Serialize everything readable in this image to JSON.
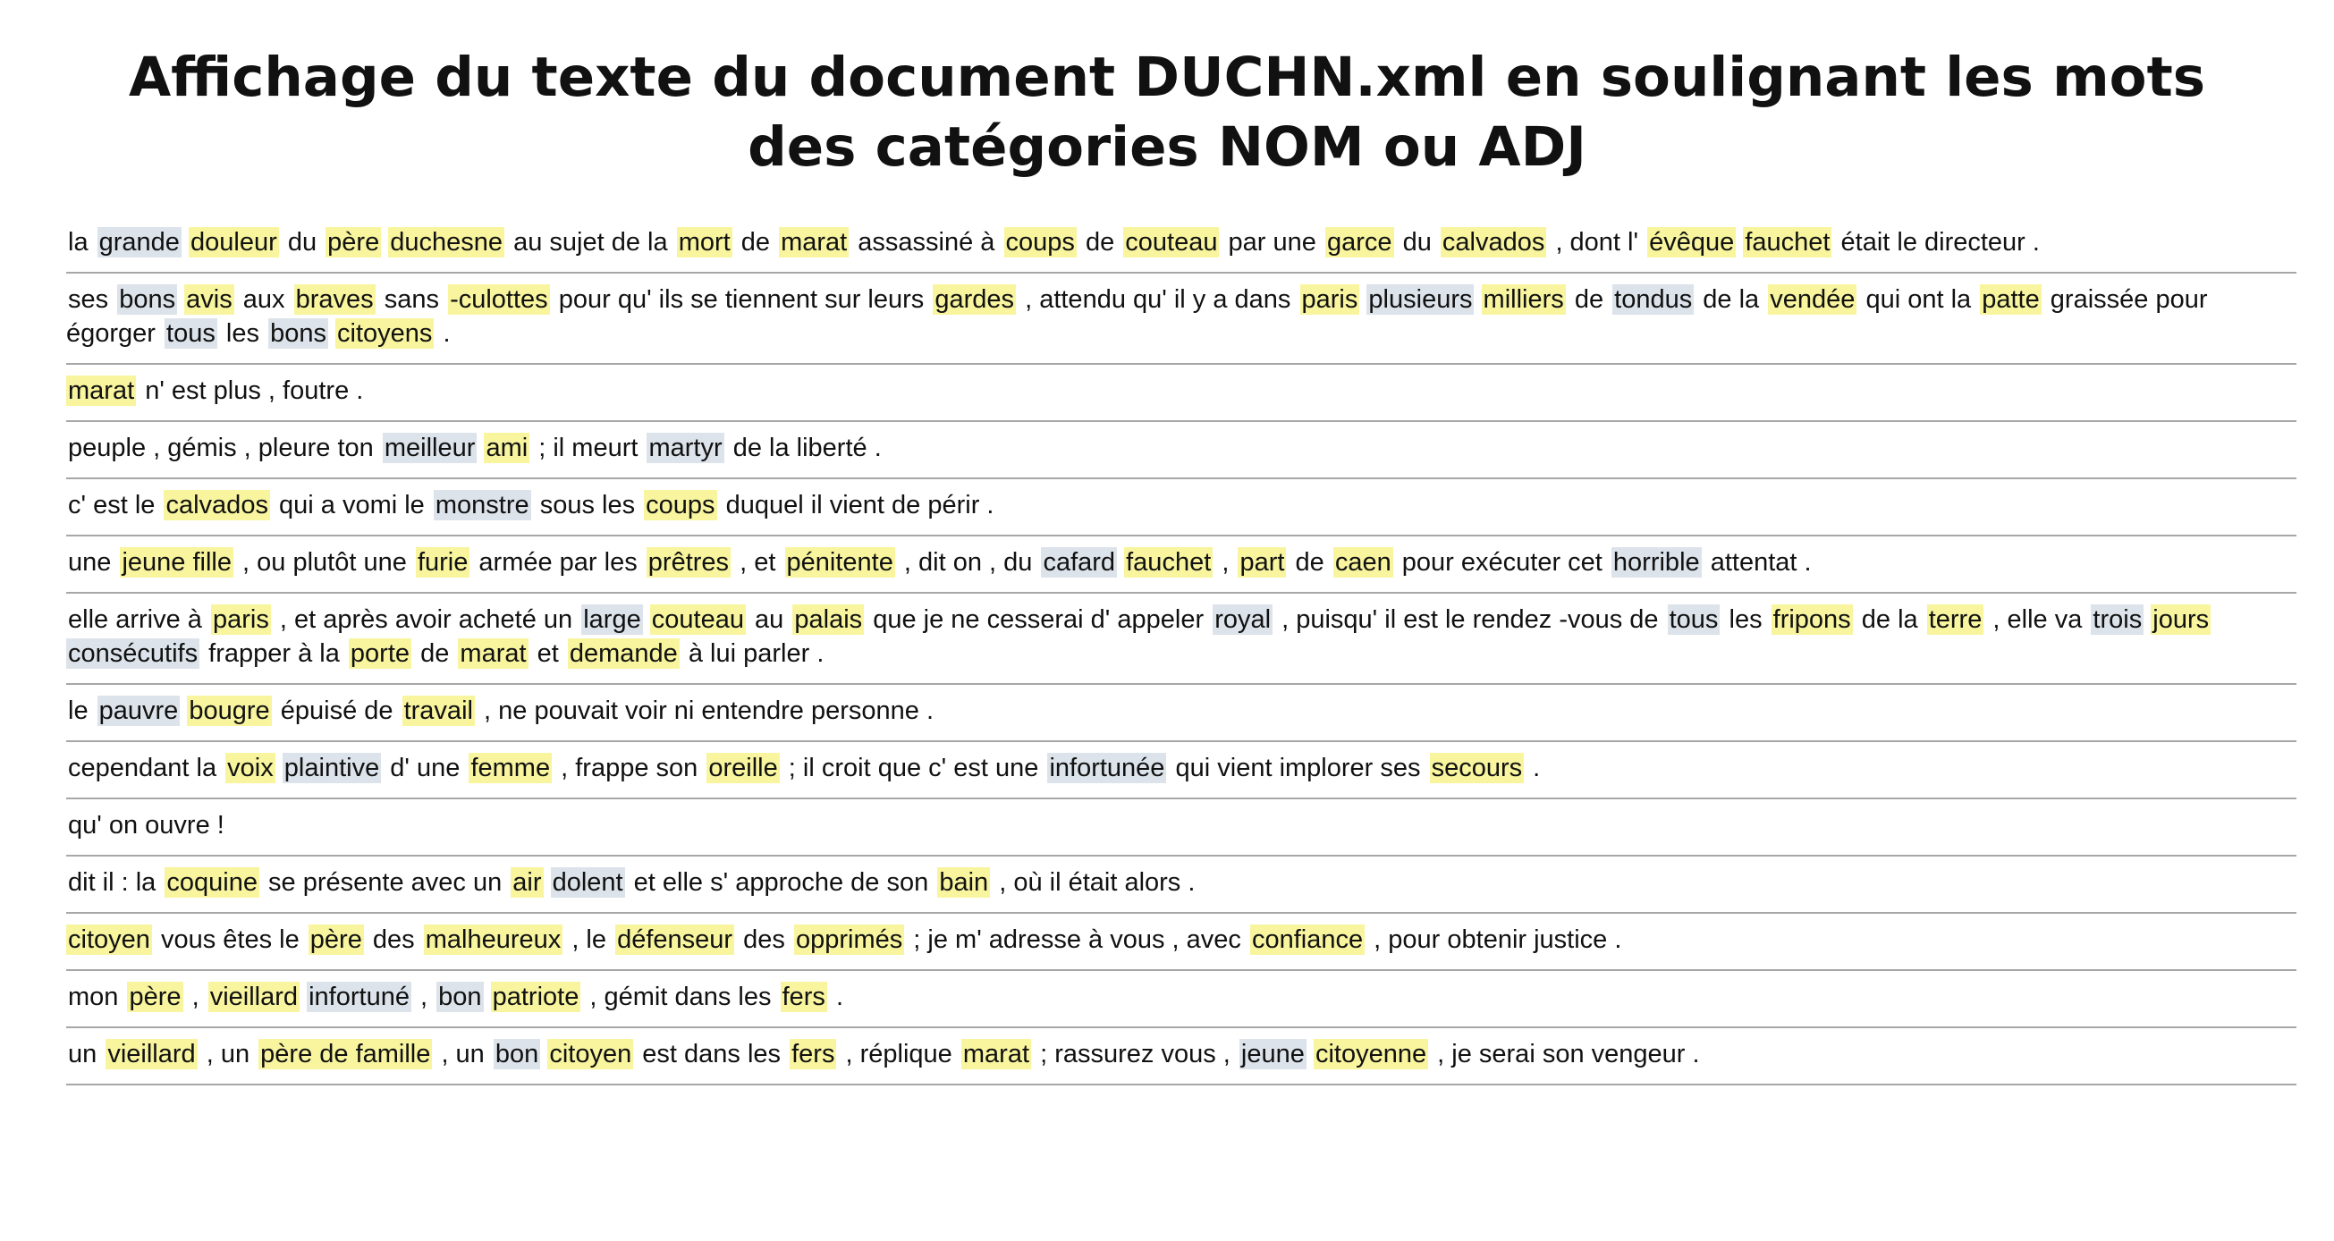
{
  "title": "Affichage du texte du document DUCHN.xml en soulignant les mots des catégories NOM ou ADJ",
  "colors": {
    "nom_highlight": "#f8f59e",
    "adj_highlight": "#dce3ea",
    "separator": "#a7a7a7"
  },
  "sentences": [
    [
      [
        "la",
        ""
      ],
      [
        "grande",
        "ADJ"
      ],
      [
        "douleur",
        "NOM"
      ],
      [
        "du",
        ""
      ],
      [
        "père",
        "NOM"
      ],
      [
        "duchesne",
        "NOM"
      ],
      [
        "au sujet de la",
        ""
      ],
      [
        "mort",
        "NOM"
      ],
      [
        "de",
        ""
      ],
      [
        "marat",
        "NOM"
      ],
      [
        "assassiné à",
        ""
      ],
      [
        "coups",
        "NOM"
      ],
      [
        "de",
        ""
      ],
      [
        "couteau",
        "NOM"
      ],
      [
        "par une",
        ""
      ],
      [
        "garce",
        "NOM"
      ],
      [
        "du",
        ""
      ],
      [
        "calvados",
        "NOM"
      ],
      [
        ", dont l'",
        ""
      ],
      [
        "évêque",
        "NOM"
      ],
      [
        "fauchet",
        "NOM"
      ],
      [
        "était le directeur .",
        ""
      ]
    ],
    [
      [
        "ses",
        ""
      ],
      [
        "bons",
        "ADJ"
      ],
      [
        "avis",
        "NOM"
      ],
      [
        "aux",
        ""
      ],
      [
        "braves",
        "NOM"
      ],
      [
        "sans",
        ""
      ],
      [
        "-culottes",
        "NOM"
      ],
      [
        "pour qu' ils se tiennent sur leurs",
        ""
      ],
      [
        "gardes",
        "NOM"
      ],
      [
        ", attendu qu' il y a dans",
        ""
      ],
      [
        "paris",
        "NOM"
      ],
      [
        "plusieurs",
        "ADJ"
      ],
      [
        "milliers",
        "NOM"
      ],
      [
        "de",
        ""
      ],
      [
        "tondus",
        "ADJ"
      ],
      [
        "de la",
        ""
      ],
      [
        "vendée",
        "NOM"
      ],
      [
        "qui ont la",
        ""
      ],
      [
        "patte",
        "NOM"
      ],
      [
        "graissée pour égorger",
        ""
      ],
      [
        "tous",
        "ADJ"
      ],
      [
        "les",
        ""
      ],
      [
        "bons",
        "ADJ"
      ],
      [
        "citoyens",
        "NOM"
      ],
      [
        ".",
        ""
      ]
    ],
    [
      [
        "marat",
        "NOM"
      ],
      [
        "n' est plus , foutre .",
        ""
      ]
    ],
    [
      [
        "peuple , gémis , pleure ton",
        ""
      ],
      [
        "meilleur",
        "ADJ"
      ],
      [
        "ami",
        "NOM"
      ],
      [
        "; il meurt",
        ""
      ],
      [
        "martyr",
        "ADJ"
      ],
      [
        "de la liberté .",
        ""
      ]
    ],
    [
      [
        "c' est le",
        ""
      ],
      [
        "calvados",
        "NOM"
      ],
      [
        "qui a vomi le",
        ""
      ],
      [
        "monstre",
        "ADJ"
      ],
      [
        "sous les",
        ""
      ],
      [
        "coups",
        "NOM"
      ],
      [
        "duquel il vient de périr .",
        ""
      ]
    ],
    [
      [
        "une",
        ""
      ],
      [
        "jeune fille",
        "NOM"
      ],
      [
        ", ou plutôt une",
        ""
      ],
      [
        "furie",
        "NOM"
      ],
      [
        "armée par les",
        ""
      ],
      [
        "prêtres",
        "NOM"
      ],
      [
        ", et",
        ""
      ],
      [
        "pénitente",
        "NOM"
      ],
      [
        ", dit on , du",
        ""
      ],
      [
        "cafard",
        "ADJ"
      ],
      [
        "fauchet",
        "NOM"
      ],
      [
        ",",
        ""
      ],
      [
        "part",
        "NOM"
      ],
      [
        "de",
        ""
      ],
      [
        "caen",
        "NOM"
      ],
      [
        "pour exécuter cet",
        ""
      ],
      [
        "horrible",
        "ADJ"
      ],
      [
        "attentat .",
        ""
      ]
    ],
    [
      [
        "elle arrive à",
        ""
      ],
      [
        "paris",
        "NOM"
      ],
      [
        ", et après avoir acheté un",
        ""
      ],
      [
        "large",
        "ADJ"
      ],
      [
        "couteau",
        "NOM"
      ],
      [
        "au",
        ""
      ],
      [
        "palais",
        "NOM"
      ],
      [
        "que je ne cesserai d' appeler",
        ""
      ],
      [
        "royal",
        "ADJ"
      ],
      [
        ", puisqu' il est le rendez -vous de",
        ""
      ],
      [
        "tous",
        "ADJ"
      ],
      [
        "les",
        ""
      ],
      [
        "fripons",
        "NOM"
      ],
      [
        "de la",
        ""
      ],
      [
        "terre",
        "NOM"
      ],
      [
        ", elle va",
        ""
      ],
      [
        "trois",
        "ADJ"
      ],
      [
        "jours",
        "NOM"
      ],
      [
        "consécutifs",
        "ADJ"
      ],
      [
        "frapper à la",
        ""
      ],
      [
        "porte",
        "NOM"
      ],
      [
        "de",
        ""
      ],
      [
        "marat",
        "NOM"
      ],
      [
        "et",
        ""
      ],
      [
        "demande",
        "NOM"
      ],
      [
        "à lui parler .",
        ""
      ]
    ],
    [
      [
        "le",
        ""
      ],
      [
        "pauvre",
        "ADJ"
      ],
      [
        "bougre",
        "NOM"
      ],
      [
        "épuisé de",
        ""
      ],
      [
        "travail",
        "NOM"
      ],
      [
        ", ne pouvait voir ni entendre personne .",
        ""
      ]
    ],
    [
      [
        "cependant la",
        ""
      ],
      [
        "voix",
        "NOM"
      ],
      [
        "plaintive",
        "ADJ"
      ],
      [
        "d' une",
        ""
      ],
      [
        "femme",
        "NOM"
      ],
      [
        ", frappe son",
        ""
      ],
      [
        "oreille",
        "NOM"
      ],
      [
        "; il croit que c' est une",
        ""
      ],
      [
        "infortunée",
        "ADJ"
      ],
      [
        "qui vient implorer ses",
        ""
      ],
      [
        "secours",
        "NOM"
      ],
      [
        ".",
        ""
      ]
    ],
    [
      [
        "qu' on ouvre !",
        ""
      ]
    ],
    [
      [
        "dit il : la",
        ""
      ],
      [
        "coquine",
        "NOM"
      ],
      [
        "se présente avec un",
        ""
      ],
      [
        "air",
        "NOM"
      ],
      [
        "dolent",
        "ADJ"
      ],
      [
        "et elle s' approche de son",
        ""
      ],
      [
        "bain",
        "NOM"
      ],
      [
        ", où il était alors .",
        ""
      ]
    ],
    [
      [
        "citoyen",
        "NOM"
      ],
      [
        "vous êtes le",
        ""
      ],
      [
        "père",
        "NOM"
      ],
      [
        "des",
        ""
      ],
      [
        "malheureux",
        "NOM"
      ],
      [
        ", le",
        ""
      ],
      [
        "défenseur",
        "NOM"
      ],
      [
        "des",
        ""
      ],
      [
        "opprimés",
        "NOM"
      ],
      [
        "; je m' adresse à vous , avec",
        ""
      ],
      [
        "confiance",
        "NOM"
      ],
      [
        ", pour obtenir justice .",
        ""
      ]
    ],
    [
      [
        "mon",
        ""
      ],
      [
        "père",
        "NOM"
      ],
      [
        ",",
        ""
      ],
      [
        "vieillard",
        "NOM"
      ],
      [
        "infortuné",
        "ADJ"
      ],
      [
        ",",
        ""
      ],
      [
        "bon",
        "ADJ"
      ],
      [
        "patriote",
        "NOM"
      ],
      [
        ", gémit dans les",
        ""
      ],
      [
        "fers",
        "NOM"
      ],
      [
        ".",
        ""
      ]
    ],
    [
      [
        "un",
        ""
      ],
      [
        "vieillard",
        "NOM"
      ],
      [
        ", un",
        ""
      ],
      [
        "père de famille",
        "NOM"
      ],
      [
        ", un",
        ""
      ],
      [
        "bon",
        "ADJ"
      ],
      [
        "citoyen",
        "NOM"
      ],
      [
        "est dans les",
        ""
      ],
      [
        "fers",
        "NOM"
      ],
      [
        ", réplique",
        ""
      ],
      [
        "marat",
        "NOM"
      ],
      [
        "; rassurez vous ,",
        ""
      ],
      [
        "jeune",
        "ADJ"
      ],
      [
        "citoyenne",
        "NOM"
      ],
      [
        ", je serai son vengeur .",
        ""
      ]
    ]
  ]
}
